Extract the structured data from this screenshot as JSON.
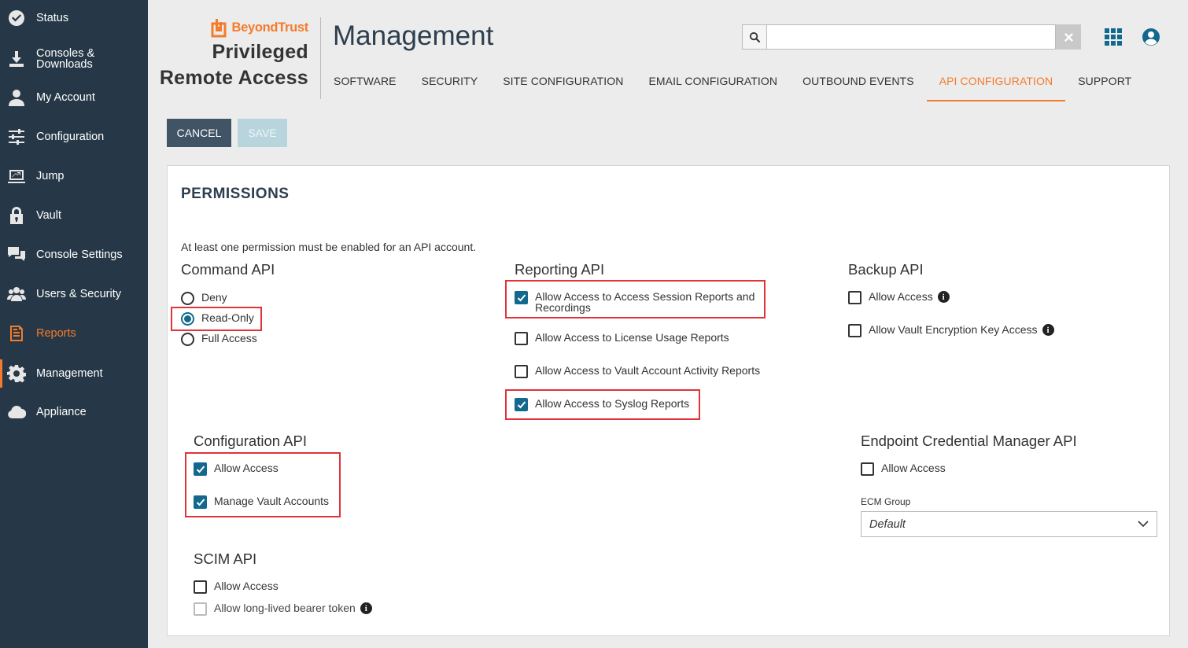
{
  "sidebar": {
    "items": [
      {
        "label": "Status",
        "icon": "check-circle-icon"
      },
      {
        "label": "Consoles & Downloads",
        "icon": "download-icon"
      },
      {
        "label": "My Account",
        "icon": "user-icon"
      },
      {
        "label": "Configuration",
        "icon": "sliders-icon"
      },
      {
        "label": "Jump",
        "icon": "jump-icon"
      },
      {
        "label": "Vault",
        "icon": "lock-icon"
      },
      {
        "label": "Console Settings",
        "icon": "chat-icon"
      },
      {
        "label": "Users & Security",
        "icon": "users-icon"
      },
      {
        "label": "Reports",
        "icon": "report-icon"
      },
      {
        "label": "Management",
        "icon": "gear-icon"
      },
      {
        "label": "Appliance",
        "icon": "cloud-icon"
      }
    ]
  },
  "header": {
    "brand": "BeyondTrust",
    "product_line1": "Privileged",
    "product_line2": "Remote Access",
    "title": "Management",
    "search_value": ""
  },
  "tabs": [
    "SOFTWARE",
    "SECURITY",
    "SITE CONFIGURATION",
    "EMAIL CONFIGURATION",
    "OUTBOUND EVENTS",
    "API CONFIGURATION",
    "SUPPORT"
  ],
  "active_tab": "API CONFIGURATION",
  "actions": {
    "cancel": "CANCEL",
    "save": "SAVE"
  },
  "permissions": {
    "title": "PERMISSIONS",
    "note": "At least one permission must be enabled for an API account.",
    "command_api": {
      "title": "Command API",
      "options": [
        "Deny",
        "Read-Only",
        "Full Access"
      ],
      "selected": "Read-Only"
    },
    "reporting_api": {
      "title": "Reporting API",
      "session_reports": "Allow Access to Access Session Reports and Recordings",
      "license_reports": "Allow Access to License Usage Reports",
      "vault_reports": "Allow Access to Vault Account Activity Reports",
      "syslog_reports": "Allow Access to Syslog Reports"
    },
    "backup_api": {
      "title": "Backup API",
      "allow_access": "Allow Access",
      "vault_key": "Allow Vault Encryption Key Access"
    },
    "configuration_api": {
      "title": "Configuration API",
      "allow_access": "Allow Access",
      "manage_vault": "Manage Vault Accounts"
    },
    "ecm_api": {
      "title": "Endpoint Credential Manager API",
      "allow_access": "Allow Access",
      "group_label": "ECM Group",
      "group_value": "Default"
    },
    "scim_api": {
      "title": "SCIM API",
      "allow_access": "Allow Access",
      "bearer_token": "Allow long-lived bearer token"
    }
  },
  "colors": {
    "accent": "#f47b2a",
    "sidebar": "#263847",
    "checked": "#12688d",
    "highlight": "#e0333a"
  }
}
